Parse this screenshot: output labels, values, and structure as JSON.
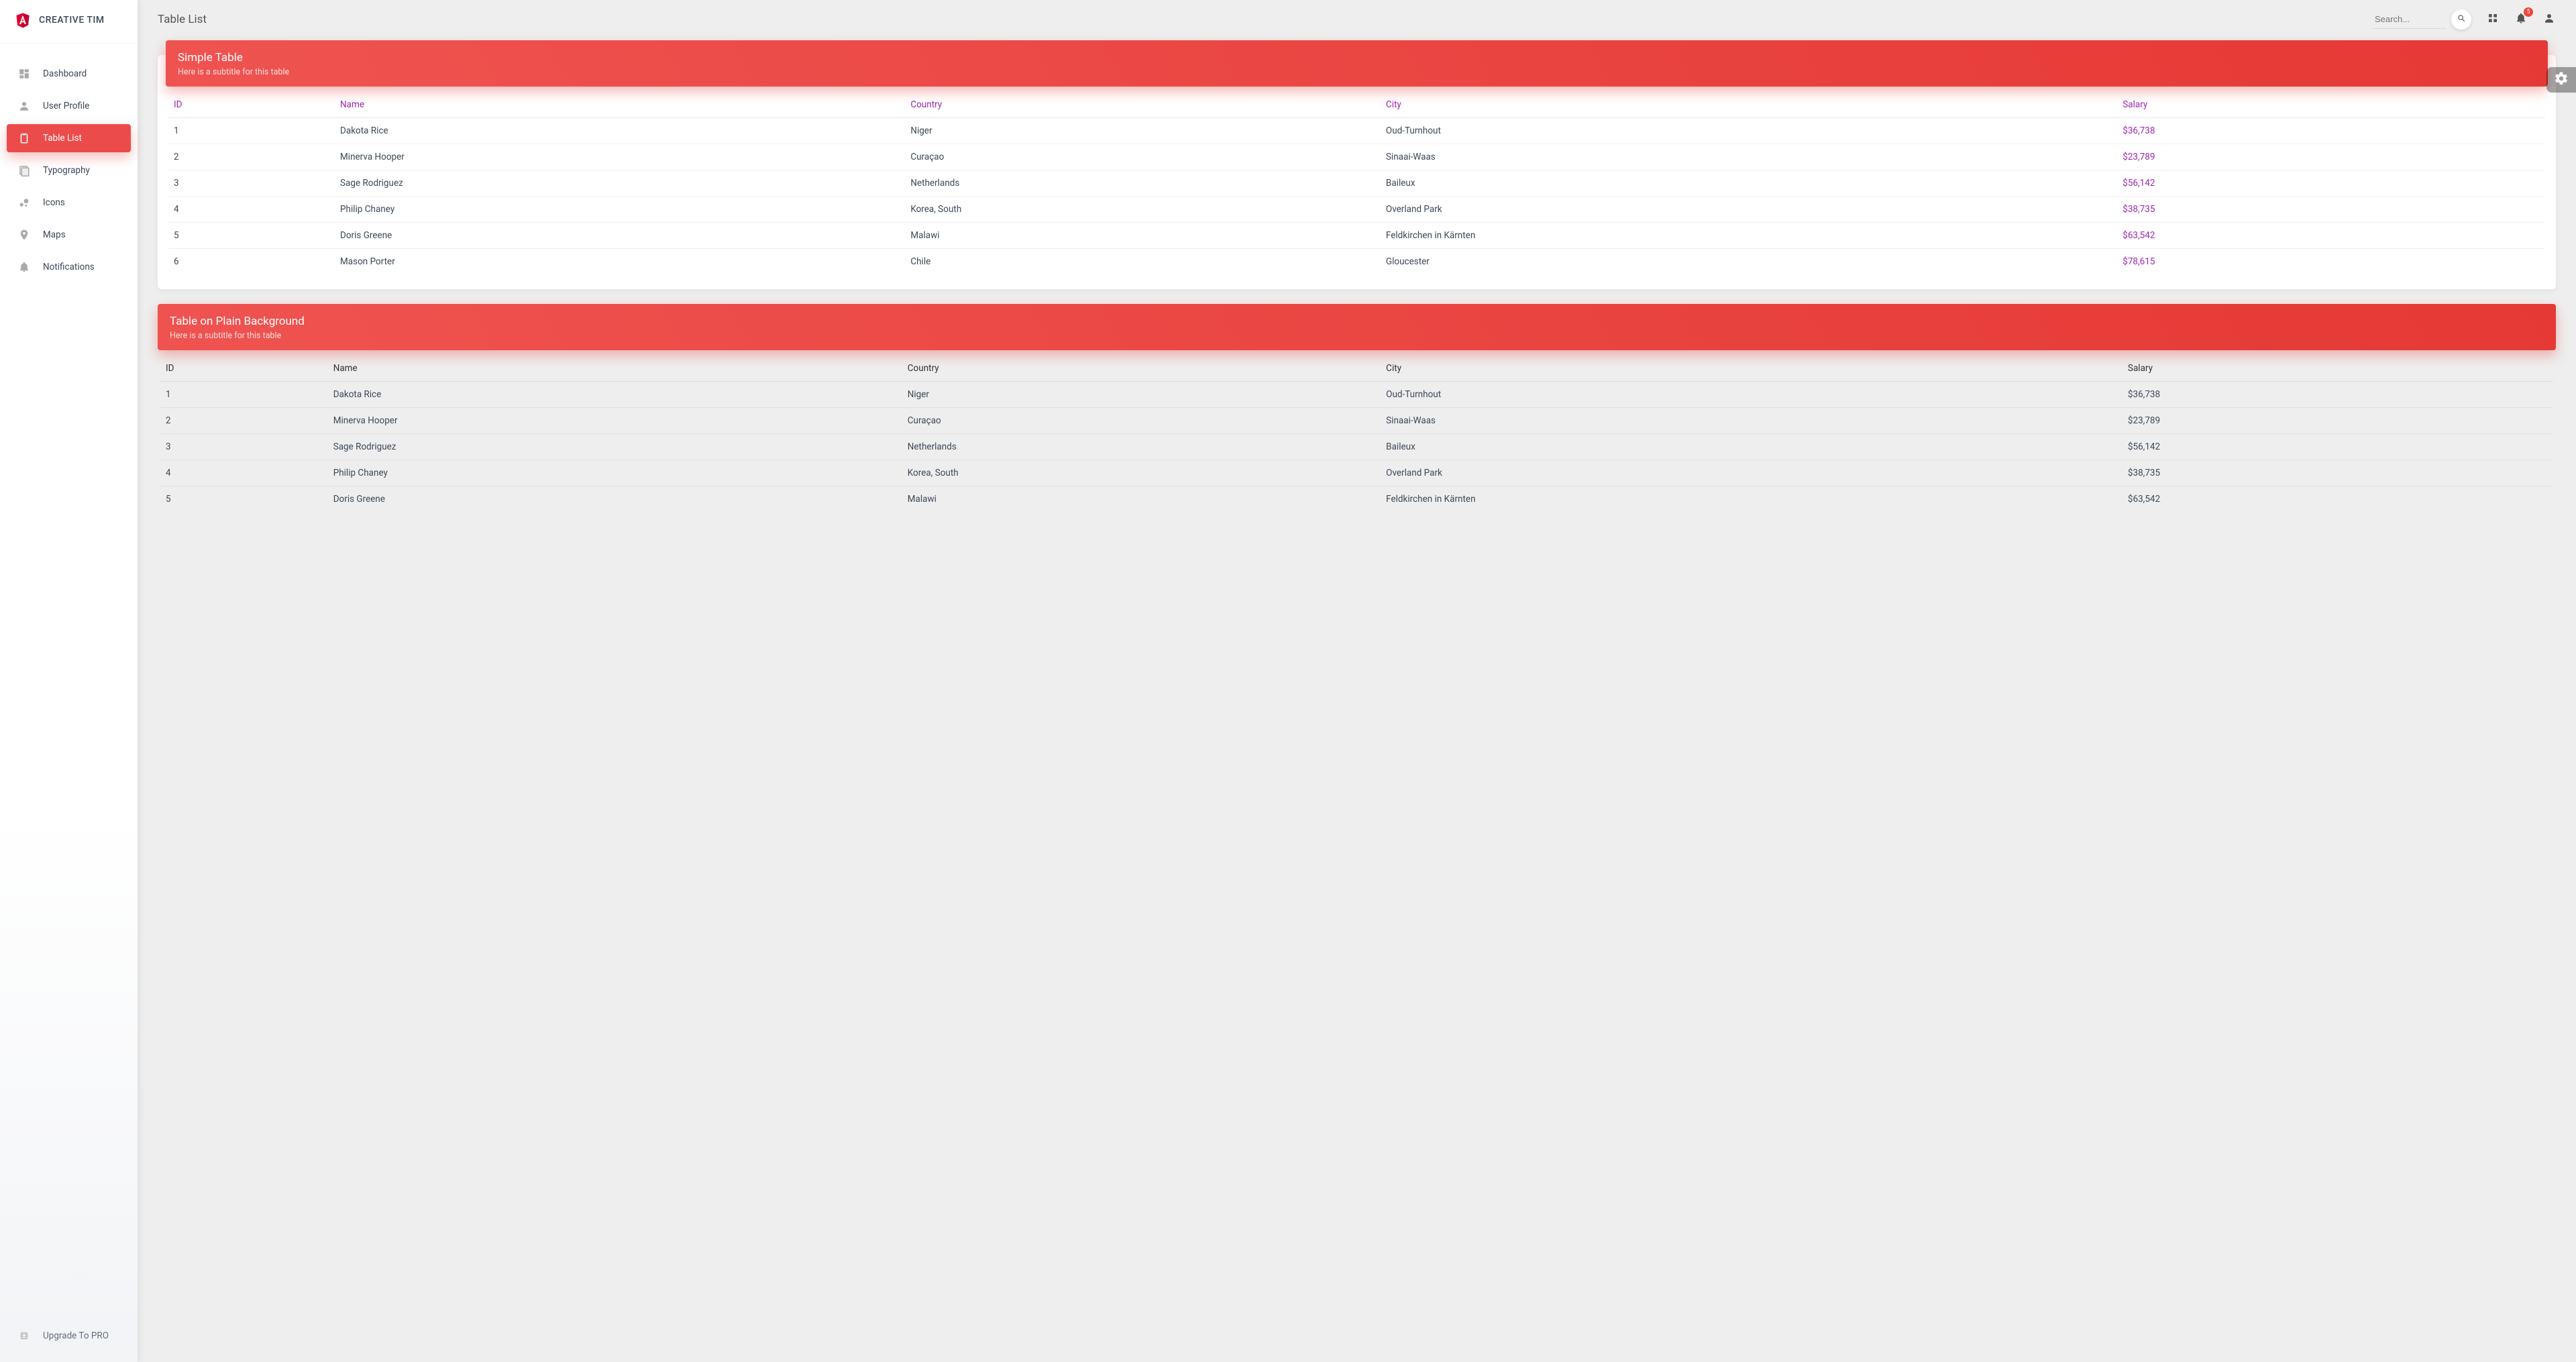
{
  "brand": {
    "title": "CREATIVE TIM"
  },
  "sidebar": {
    "items": [
      {
        "label": "Dashboard",
        "icon": "dashboard",
        "active": false
      },
      {
        "label": "User Profile",
        "icon": "person",
        "active": false
      },
      {
        "label": "Table List",
        "icon": "clipboard",
        "active": true
      },
      {
        "label": "Typography",
        "icon": "library",
        "active": false
      },
      {
        "label": "Icons",
        "icon": "bubbles",
        "active": false
      },
      {
        "label": "Maps",
        "icon": "pin",
        "active": false
      },
      {
        "label": "Notifications",
        "icon": "bell",
        "active": false
      }
    ],
    "upgrade_label": "Upgrade To PRO"
  },
  "header": {
    "page_title": "Table List",
    "search_placeholder": "Search...",
    "notification_count": "5"
  },
  "tables": [
    {
      "title": "Simple Table",
      "subtitle": "Here is a subtitle for this table",
      "style": "card",
      "columns": [
        "ID",
        "Name",
        "Country",
        "City",
        "Salary"
      ],
      "rows": [
        {
          "id": "1",
          "name": "Dakota Rice",
          "country": "Niger",
          "city": "Oud-Turnhout",
          "salary": "$36,738"
        },
        {
          "id": "2",
          "name": "Minerva Hooper",
          "country": "Curaçao",
          "city": "Sinaai-Waas",
          "salary": "$23,789"
        },
        {
          "id": "3",
          "name": "Sage Rodriguez",
          "country": "Netherlands",
          "city": "Baileux",
          "salary": "$56,142"
        },
        {
          "id": "4",
          "name": "Philip Chaney",
          "country": "Korea, South",
          "city": "Overland Park",
          "salary": "$38,735"
        },
        {
          "id": "5",
          "name": "Doris Greene",
          "country": "Malawi",
          "city": "Feldkirchen in Kärnten",
          "salary": "$63,542"
        },
        {
          "id": "6",
          "name": "Mason Porter",
          "country": "Chile",
          "city": "Gloucester",
          "salary": "$78,615"
        }
      ]
    },
    {
      "title": "Table on Plain Background",
      "subtitle": "Here is a subtitle for this table",
      "style": "plain",
      "columns": [
        "ID",
        "Name",
        "Country",
        "City",
        "Salary"
      ],
      "rows": [
        {
          "id": "1",
          "name": "Dakota Rice",
          "country": "Niger",
          "city": "Oud-Turnhout",
          "salary": "$36,738"
        },
        {
          "id": "2",
          "name": "Minerva Hooper",
          "country": "Curaçao",
          "city": "Sinaai-Waas",
          "salary": "$23,789"
        },
        {
          "id": "3",
          "name": "Sage Rodriguez",
          "country": "Netherlands",
          "city": "Baileux",
          "salary": "$56,142"
        },
        {
          "id": "4",
          "name": "Philip Chaney",
          "country": "Korea, South",
          "city": "Overland Park",
          "salary": "$38,735"
        },
        {
          "id": "5",
          "name": "Doris Greene",
          "country": "Malawi",
          "city": "Feldkirchen in Kärnten",
          "salary": "$63,542"
        }
      ]
    }
  ],
  "colors": {
    "primary": "#ec4b4b",
    "accent": "#9c27b0"
  }
}
